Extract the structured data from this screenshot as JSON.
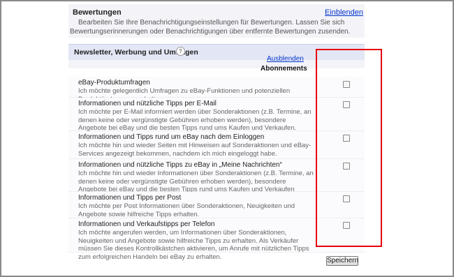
{
  "bewertungen": {
    "title": "Bewertungen",
    "toggle": "Einblenden",
    "description": "Bearbeiten Sie Ihre Benachrichtigungseinstellungen für Bewertungen. Lassen Sie sich Bewertungserinnerungen oder Benachrichtigungen über entfernte Bewertungen zusenden."
  },
  "newsletter": {
    "title": "Newsletter, Werbung und Umfragen",
    "help_icon": "help-icon",
    "toggle": "Ausblenden",
    "column_header": "Abonnements",
    "items": [
      {
        "title": "eBay-Produktumfragen",
        "desc": "Ich möchte gelegentlich Umfragen zu eBay-Funktionen und potenziellen Produktänderungen erhalten.",
        "checked": false
      },
      {
        "title": "Informationen und nützliche Tipps per E-Mail",
        "desc": "Ich möchte per E-Mail informiert werden über Sonderaktionen (z.B. Termine, an denen keine oder vergünstigte Gebühren erhoben werden), besondere Angebote bei eBay und die besten Tipps rund ums Kaufen und Verkaufen.",
        "checked": false
      },
      {
        "title": "Informationen und Tipps rund um eBay nach dem Einloggen",
        "desc": "Ich möchte hin und wieder Seiten mit Hinweisen auf Sonderaktionen und eBay-Services angezeigt bekommen, nachdem ich mich eingeloggt habe.",
        "checked": false
      },
      {
        "title": "Informationen und nützliche Tipps zu eBay in „Meine Nachrichten“",
        "desc": "Ich möchte hin und wieder Informationen über Sonderaktionen (z.B. Termine, an denen keine oder vergünstigte Gebühren erhoben werden), besondere Angebote bei eBay und die besten Tipps rund ums Kaufen und Verkaufen erhalten.",
        "checked": false
      },
      {
        "title": "Informationen und Tipps per Post",
        "desc": "Ich möchte per Post Informationen über Sonderaktionen, Neuigkeiten und Angebote sowie hilfreiche Tipps erhalten.",
        "checked": false
      },
      {
        "title": "Informationen und Verkaufstipps per Telefon",
        "desc": "Ich möchte angerufen werden, um Informationen über Sonderaktionen, Neuigkeiten und Angebote sowie hilfreiche Tipps zu erhalten. Als Verkäufer müssen Sie dieses Kontrollkästchen aktivieren, um Anrufe mit nützlichen Tipps zum erfolgreichen Handeln bei eBay zu erhalten.",
        "checked": false
      }
    ]
  },
  "save_label": "Speichern",
  "highlight_color": "#e8000f",
  "link_color": "#0033cc"
}
